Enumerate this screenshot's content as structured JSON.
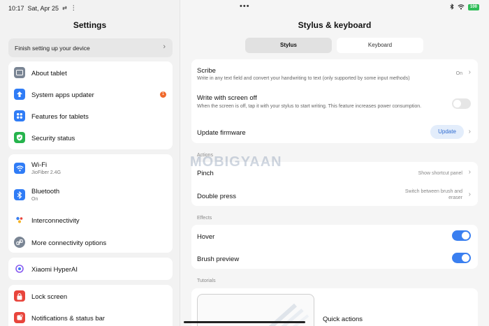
{
  "status_bar": {
    "time": "10:17",
    "date": "Sat, Apr 25",
    "dots": "•••",
    "battery": "100"
  },
  "settings": {
    "title": "Settings",
    "setup_banner": "Finish setting up your device",
    "groups": [
      {
        "items": [
          {
            "label": "About tablet",
            "icon": "tablet-icon",
            "color": "#7a8594"
          },
          {
            "label": "System apps updater",
            "icon": "arrow-up-icon",
            "color": "#2f7cf6",
            "badge": "1"
          },
          {
            "label": "Features for tablets",
            "icon": "grid-icon",
            "color": "#2f7cf6"
          },
          {
            "label": "Security status",
            "icon": "shield-icon",
            "color": "#26b44d"
          }
        ]
      },
      {
        "items": [
          {
            "label": "Wi-Fi",
            "sub": "JioFiber 2.4G",
            "icon": "wifi-icon",
            "color": "#2f7cf6"
          },
          {
            "label": "Bluetooth",
            "sub": "On",
            "icon": "bluetooth-icon",
            "color": "#2f7cf6"
          },
          {
            "label": "Interconnectivity",
            "icon": "interconnect-icon",
            "color": "#ffffff"
          },
          {
            "label": "More connectivity options",
            "icon": "link-icon",
            "color": "#7a8594"
          }
        ]
      },
      {
        "items": [
          {
            "label": "Xiaomi HyperAI",
            "icon": "hyperai-icon",
            "color": "#ffffff"
          }
        ]
      },
      {
        "items": [
          {
            "label": "Lock screen",
            "icon": "lock-icon",
            "color": "#e8453c"
          },
          {
            "label": "Notifications & status bar",
            "icon": "bell-icon",
            "color": "#e8453c"
          }
        ]
      }
    ]
  },
  "detail": {
    "title": "Stylus & keyboard",
    "tabs": [
      {
        "label": "Stylus",
        "active": true
      },
      {
        "label": "Keyboard",
        "active": false
      }
    ],
    "scribe": {
      "title": "Scribe",
      "desc": "Write in any text field and convert your handwriting to text (only supported by some input methods)",
      "value": "On"
    },
    "write_off": {
      "title": "Write with screen off",
      "desc": "When the screen is off, tap it with your stylus to start writing. This feature increases power consumption.",
      "enabled": false
    },
    "firmware": {
      "title": "Update firmware",
      "button": "Update"
    },
    "actions_label": "Actions",
    "pinch": {
      "title": "Pinch",
      "value": "Show shortcut panel"
    },
    "double_press": {
      "title": "Double press",
      "value": "Switch between brush and eraser"
    },
    "effects_label": "Effects",
    "hover": {
      "title": "Hover",
      "enabled": true
    },
    "brush_preview": {
      "title": "Brush preview",
      "enabled": true
    },
    "tutorials_label": "Tutorials",
    "tutorial": {
      "title": "Quick actions"
    }
  },
  "watermark": "MOBIGYAAN",
  "colors": {
    "accent": "#3a7ff0",
    "badge": "#f0692c"
  }
}
